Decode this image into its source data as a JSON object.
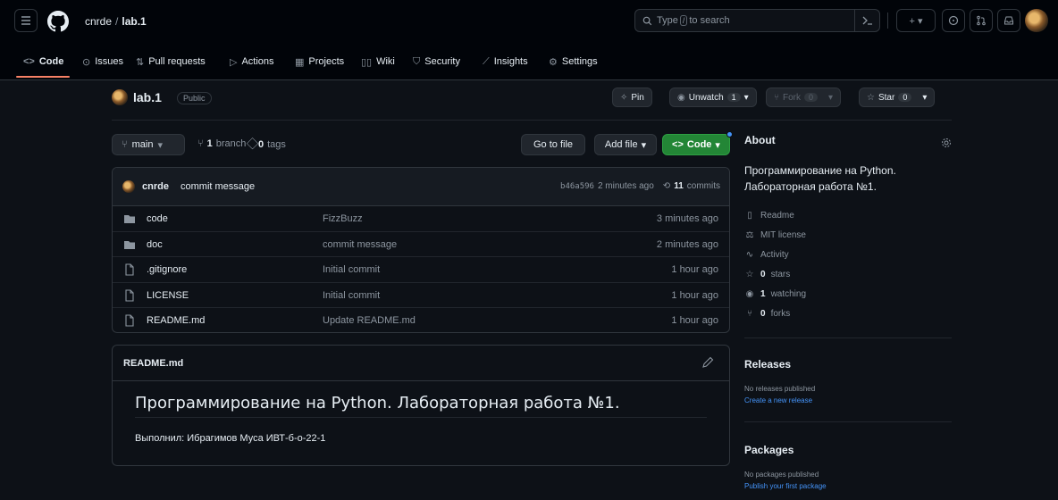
{
  "header": {
    "owner": "cnrde",
    "separator": "/",
    "repo": "lab.1",
    "search_prefix": "Type",
    "search_key": "/",
    "search_suffix": "to search",
    "plus_label": "+ ▾"
  },
  "tabs": [
    {
      "label": "Code",
      "icon": "code-icon"
    },
    {
      "label": "Issues",
      "icon": "issue-icon"
    },
    {
      "label": "Pull requests",
      "icon": "pull-request-icon"
    },
    {
      "label": "Actions",
      "icon": "play-icon"
    },
    {
      "label": "Projects",
      "icon": "table-icon"
    },
    {
      "label": "Wiki",
      "icon": "book-icon"
    },
    {
      "label": "Security",
      "icon": "shield-icon"
    },
    {
      "label": "Insights",
      "icon": "graph-icon"
    },
    {
      "label": "Settings",
      "icon": "gear-icon"
    }
  ],
  "repohead": {
    "name": "lab.1",
    "visibility": "Public",
    "pin": "Pin",
    "unwatch": "Unwatch",
    "unwatch_count": "1",
    "fork": "Fork",
    "fork_count": "0",
    "star": "Star",
    "star_count": "0"
  },
  "bar": {
    "branch": "main",
    "branches_count": "1",
    "branches_label": "branch",
    "tags_count": "0",
    "tags_label": "tags",
    "go_to_file": "Go to file",
    "add_file": "Add file",
    "code": "Code"
  },
  "commit": {
    "author": "cnrde",
    "message": "commit message",
    "hash": "b46a596",
    "time": "2 minutes ago",
    "commits_count": "11",
    "commits_label": "commits"
  },
  "files": [
    {
      "name": "code",
      "type": "folder",
      "message": "FizzBuzz",
      "time": "3 minutes ago"
    },
    {
      "name": "doc",
      "type": "folder",
      "message": "commit message",
      "time": "2 minutes ago"
    },
    {
      "name": ".gitignore",
      "type": "file",
      "message": "Initial commit",
      "time": "1 hour ago"
    },
    {
      "name": "LICENSE",
      "type": "file",
      "message": "Initial commit",
      "time": "1 hour ago"
    },
    {
      "name": "README.md",
      "type": "file",
      "message": "Update README.md",
      "time": "1 hour ago"
    }
  ],
  "readme": {
    "title": "README.md",
    "heading": "Программирование на Python. Лабораторная работа №1.",
    "paragraph": "Выполнил: Ибрагимов Муса ИВТ-б-о-22-1"
  },
  "about": {
    "title": "About",
    "description": "Программирование на Python. Лабораторная работа №1.",
    "readme": "Readme",
    "license": "MIT license",
    "activity": "Activity",
    "stars_count": "0",
    "stars_label": "stars",
    "watching_count": "1",
    "watching_label": "watching",
    "forks_count": "0",
    "forks_label": "forks"
  },
  "releases": {
    "title": "Releases",
    "none": "No releases published",
    "create": "Create a new release"
  },
  "packages": {
    "title": "Packages",
    "none": "No packages published",
    "publish": "Publish your first package"
  },
  "colors": {
    "background": "#0d1117",
    "header": "#010409",
    "green_button": "#238636",
    "link": "#4493f8",
    "tab_underline": "#f78166"
  }
}
